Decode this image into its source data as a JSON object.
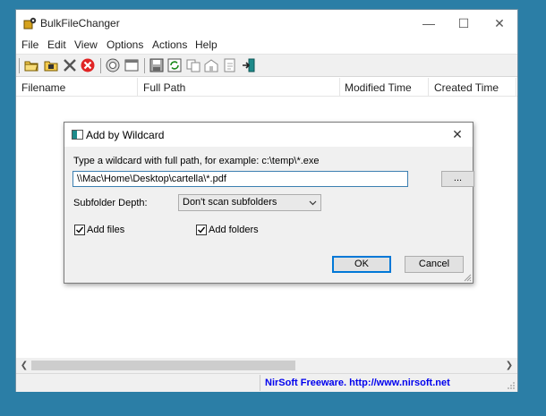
{
  "window": {
    "title": "BulkFileChanger",
    "controls": {
      "minimize": "—",
      "maximize": "☐",
      "close": "✕"
    }
  },
  "menu": [
    "File",
    "Edit",
    "View",
    "Options",
    "Actions",
    "Help"
  ],
  "toolbar_icons": [
    "open-folder-icon",
    "add-files-icon",
    "delete-x-icon",
    "stop-icon",
    "properties-icon",
    "window-icon",
    "save-icon",
    "refresh-icon",
    "copy-icon",
    "change-time-icon",
    "change-attributes-icon",
    "exit-icon"
  ],
  "columns": [
    "Filename",
    "Full Path",
    "Modified Time",
    "Created Time"
  ],
  "status": {
    "link_text": "NirSoft Freeware.  http://www.nirsoft.net"
  },
  "dialog": {
    "title": "Add by Wildcard",
    "close": "✕",
    "instruction": "Type a wildcard with full path, for example: c:\\temp\\*.exe",
    "path_value": "\\\\Mac\\Home\\Desktop\\cartella\\*.pdf",
    "browse_label": "...",
    "depth_label": "Subfolder Depth:",
    "depth_selected": "Don't scan subfolders",
    "add_files_label": "Add files",
    "add_files_checked": true,
    "add_folders_label": "Add folders",
    "add_folders_checked": true,
    "ok_label": "OK",
    "cancel_label": "Cancel"
  },
  "colors": {
    "desktop": "#2b7ea6",
    "link": "#0000ee",
    "focus_border": "#0078d7"
  }
}
